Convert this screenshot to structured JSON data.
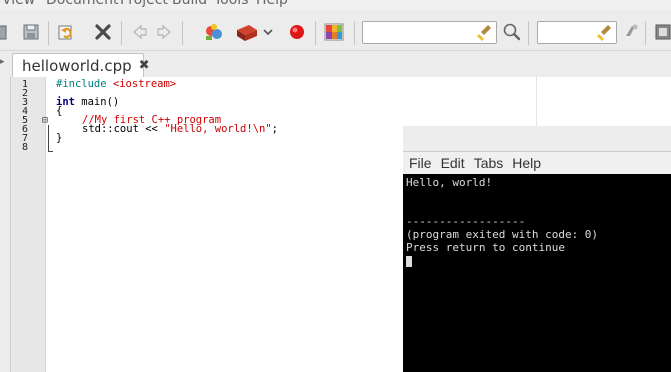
{
  "menubar": {
    "items": [
      "View",
      "Document",
      "Project",
      "Build",
      "Tools",
      "Help"
    ]
  },
  "toolbar": {
    "icons": [
      "save-all-icon",
      "reload-icon",
      "close-icon",
      "back-icon",
      "forward-icon",
      "compile-icon",
      "build-icon",
      "dropdown-icon",
      "stop-icon",
      "color-chooser-icon",
      "clear-icon",
      "find-icon",
      "goto-icon"
    ],
    "search_value": "",
    "goto_value": ""
  },
  "tabs": [
    {
      "label": "helloworld.cpp",
      "close": "✖"
    }
  ],
  "editor": {
    "line_numbers": [
      "1",
      "2",
      "3",
      "4",
      "5",
      "6",
      "7",
      "8"
    ],
    "code": {
      "line1_directive": "#include ",
      "line1_header": "<iostream>",
      "line3_type": "int",
      "line3_rest": " main()",
      "line4": "{",
      "line5_comment": "//My first C++ program",
      "line6_code": "std::cout << ",
      "line6_string": "\"Hello, world!\\n\"",
      "line6_end": ";",
      "line7": "}"
    },
    "fold_marker": "⊟"
  },
  "terminal": {
    "menu": [
      "File",
      "Edit",
      "Tabs",
      "Help"
    ],
    "lines": [
      "Hello, world!",
      "",
      "",
      "------------------",
      "(program exited with code: 0)",
      "Press return to continue"
    ]
  },
  "colors": {
    "toolbar_bg": "#ececec",
    "gutter_bg": "#e7e7e7",
    "preprocessor": "#007f7f",
    "string": "#cc0000",
    "keyword": "#00007f",
    "terminal_bg": "#000000",
    "terminal_fg": "#dcdcdc"
  }
}
